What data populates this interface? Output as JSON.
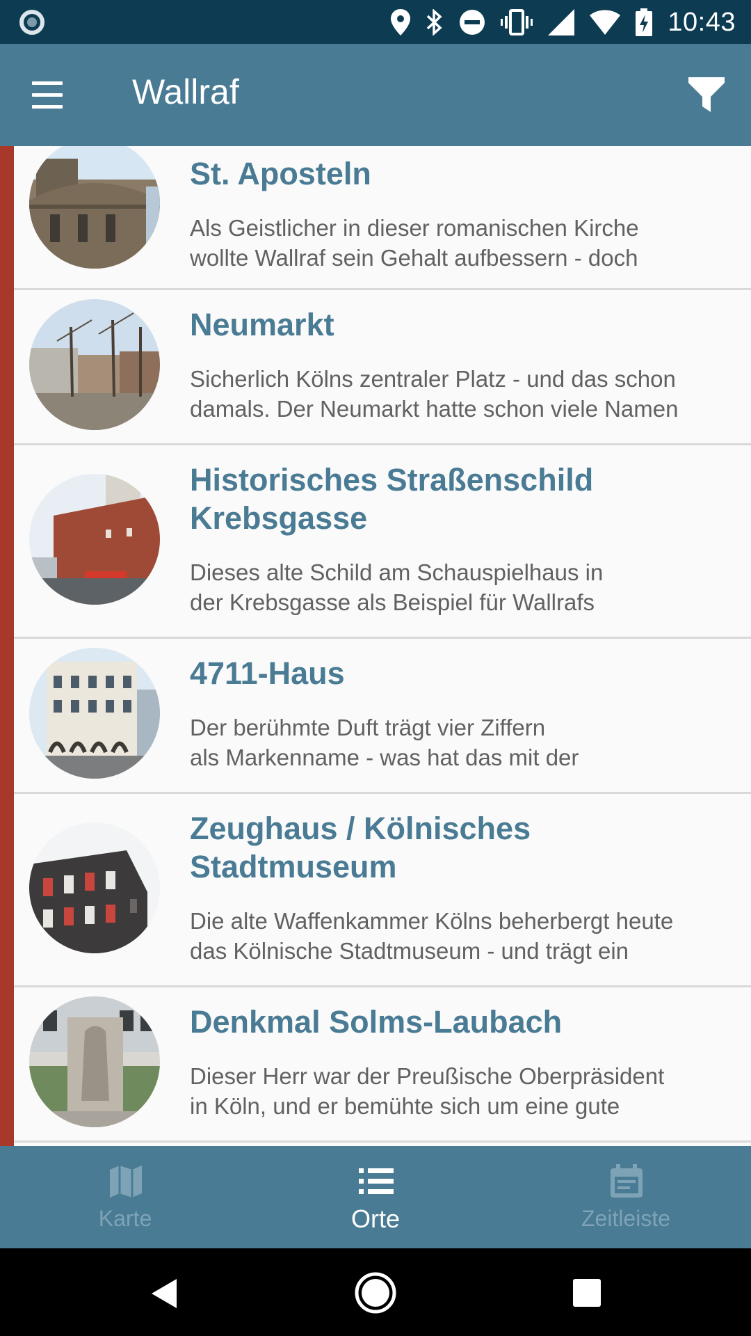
{
  "status_bar": {
    "time": "10:43",
    "icons": [
      "location-icon",
      "bluetooth-icon",
      "do-not-disturb-icon",
      "vibrate-icon",
      "signal-icon",
      "wifi-icon",
      "battery-charging-icon"
    ]
  },
  "app_bar": {
    "title": "Wallraf",
    "menu_icon": "hamburger-menu-icon",
    "filter_icon": "filter-icon"
  },
  "places": [
    {
      "title": "St. Aposteln",
      "description_lines": [
        "Als Geistlicher in dieser romanischen Kirche",
        "wollte Wallraf sein Gehalt aufbessern - doch"
      ]
    },
    {
      "title": "Neumarkt",
      "description_lines": [
        "Sicherlich Kölns zentraler Platz - und das schon",
        "damals. Der Neumarkt hatte schon viele Namen"
      ]
    },
    {
      "title_lines": [
        "Historisches Straßenschild",
        "Krebsgasse"
      ],
      "description_lines": [
        "Dieses alte Schild am Schauspielhaus in",
        "der Krebsgasse als Beispiel für Wallrafs"
      ]
    },
    {
      "title": "4711-Haus",
      "description_lines": [
        "Der berühmte Duft trägt vier Ziffern",
        "als Markenname - was hat das mit der"
      ]
    },
    {
      "title_lines": [
        "Zeughaus / Kölnisches",
        "Stadtmuseum"
      ],
      "description_lines": [
        "Die alte Waffenkammer Kölns beherbergt heute",
        "das Kölnische Stadtmuseum - und trägt ein"
      ]
    },
    {
      "title": "Denkmal Solms-Laubach",
      "description_lines": [
        "Dieser Herr war der Preußische Oberpräsident",
        "in Köln, und er bemühte sich um eine gute"
      ]
    }
  ],
  "bottom_nav": {
    "items": [
      {
        "label": "Karte",
        "icon": "map-icon",
        "active": false
      },
      {
        "label": "Orte",
        "icon": "list-icon",
        "active": true
      },
      {
        "label": "Zeitleiste",
        "icon": "calendar-icon",
        "active": false
      }
    ]
  },
  "system_nav": {
    "icons": [
      "back-icon",
      "home-icon",
      "recents-icon"
    ]
  },
  "colors": {
    "status_bar": "#0d3b52",
    "primary": "#4a7b94",
    "accent_bar": "#a8392a",
    "title_text": "#4a7b94",
    "body_text": "#616161",
    "nav_inactive": "#7ea3b6"
  }
}
